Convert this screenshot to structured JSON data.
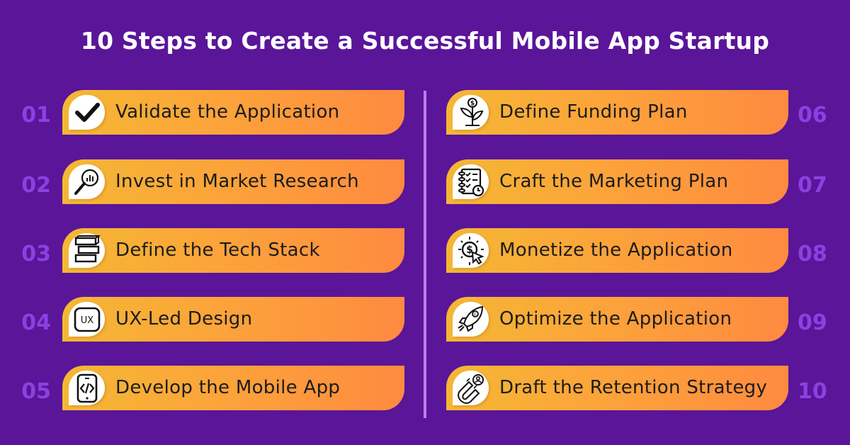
{
  "title": "10 Steps to Create a Successful Mobile App Startup",
  "colors": {
    "background": "#5a1599",
    "number": "#8e3fe0",
    "divider": "#c47be8",
    "card_gradient_start": "#f4b734",
    "card_gradient_end": "#fe8a40"
  },
  "steps": [
    {
      "number": "01",
      "label": "Validate the Application",
      "icon": "checkmark-icon"
    },
    {
      "number": "02",
      "label": "Invest in Market Research",
      "icon": "magnifier-chart-icon"
    },
    {
      "number": "03",
      "label": "Define the Tech Stack",
      "icon": "stacked-blocks-icon"
    },
    {
      "number": "04",
      "label": "UX-Led Design",
      "icon": "ux-badge-icon"
    },
    {
      "number": "05",
      "label": "Develop the Mobile App",
      "icon": "mobile-code-icon"
    },
    {
      "number": "06",
      "label": "Define Funding Plan",
      "icon": "money-plant-icon"
    },
    {
      "number": "07",
      "label": "Craft the Marketing Plan",
      "icon": "checklist-clock-icon"
    },
    {
      "number": "08",
      "label": "Monetize the Application",
      "icon": "dollar-click-icon"
    },
    {
      "number": "09",
      "label": "Optimize the Application",
      "icon": "rocket-icon"
    },
    {
      "number": "10",
      "label": "Draft the Retention Strategy",
      "icon": "magnet-user-icon"
    }
  ]
}
